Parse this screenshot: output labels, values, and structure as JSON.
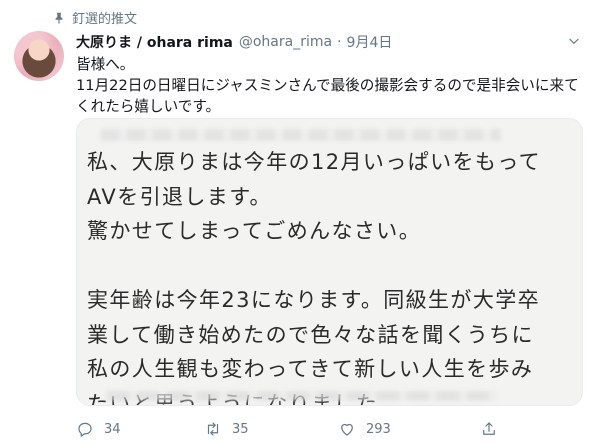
{
  "pinned": {
    "label": "釘選的推文"
  },
  "author": {
    "display_name": "大原りま / ohara rima",
    "handle": "@ohara_rima",
    "separator": "·",
    "date": "9月4日"
  },
  "tweet": {
    "text": "皆様へ。\n11月22日の日曜日にジャスミンさんで最後の撮影会するので是非会いに来て\nくれたら嬉しいです。"
  },
  "media": {
    "text": "私、大原りまは今年の12月いっぱいをもって\nAVを引退します。\n驚かせてしまってごめんなさい。\n\n実年齢は今年23になります。同級生が大学卒\n業して働き始めたので色々な話を聞くうちに\n私の人生観も変わってきて新しい人生を歩み\nたいと思うようになりました。"
  },
  "actions": {
    "replies": "34",
    "retweets": "35",
    "likes": "293"
  },
  "icons": [
    "pin-icon",
    "caret-down-icon",
    "reply-icon",
    "retweet-icon",
    "heart-icon",
    "share-icon"
  ],
  "colors": {
    "text": "#14171a",
    "secondary": "#657786"
  }
}
